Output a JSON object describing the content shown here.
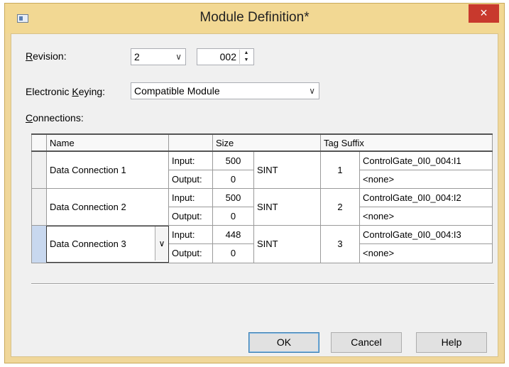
{
  "window": {
    "title": "Module Definition*",
    "close_symbol": "×"
  },
  "revision": {
    "label_u": "R",
    "label_rest": "evision:",
    "major": "2",
    "minor": "002"
  },
  "keying": {
    "label_pre": "Electronic ",
    "label_u": "K",
    "label_rest": "eying:",
    "value": "Compatible Module"
  },
  "connections": {
    "label_u": "C",
    "label_rest": "onnections:",
    "headers": {
      "name": "Name",
      "blank": "",
      "size": "Size",
      "tag_suffix": "Tag Suffix"
    },
    "rows": [
      {
        "name": "Data Connection 1",
        "input_label": "Input:",
        "output_label": "Output:",
        "input_size": "500",
        "output_size": "0",
        "type": "SINT",
        "number": "1",
        "input_tag": "ControlGate_0I0_004:I1",
        "output_tag": "<none>"
      },
      {
        "name": "Data Connection 2",
        "input_label": "Input:",
        "output_label": "Output:",
        "input_size": "500",
        "output_size": "0",
        "type": "SINT",
        "number": "2",
        "input_tag": "ControlGate_0I0_004:I2",
        "output_tag": "<none>"
      },
      {
        "name": "Data Connection 3",
        "input_label": "Input:",
        "output_label": "Output:",
        "input_size": "448",
        "output_size": "0",
        "type": "SINT",
        "number": "3",
        "input_tag": "ControlGate_0I0_004:I3",
        "output_tag": "<none>"
      }
    ]
  },
  "buttons": {
    "ok": "OK",
    "cancel": "Cancel",
    "help": "Help"
  },
  "icons": {
    "app": "window-app-icon",
    "chevron": "chevron-down-icon",
    "spin_up": "spin-up-icon",
    "spin_down": "spin-down-icon"
  },
  "colors": {
    "frame": "#f0d79a",
    "close": "#c8392d",
    "selected_row": "#c8d8ef",
    "client": "#f0f0f0"
  }
}
